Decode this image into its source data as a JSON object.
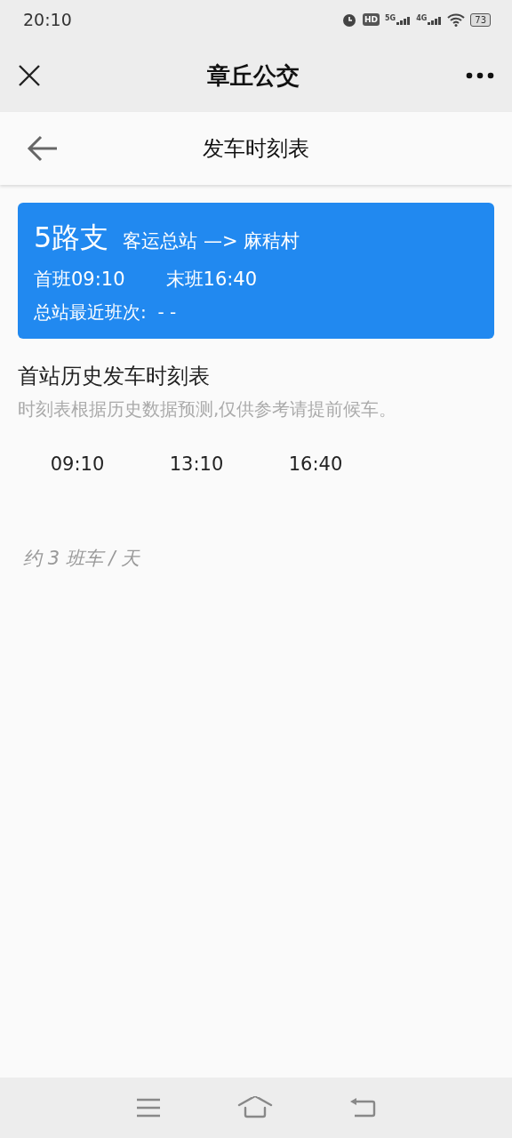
{
  "status_bar": {
    "time": "20:10",
    "hd": "HD",
    "network": [
      "5G",
      "4G"
    ],
    "battery": "73"
  },
  "window": {
    "title": "章丘公交"
  },
  "page": {
    "title": "发车时刻表"
  },
  "route_card": {
    "route": "5路支",
    "direction": "客运总站 —> 麻秸村",
    "first_bus": "首班09:10",
    "last_bus": "末班16:40",
    "latest": "总站最近班次:  - -"
  },
  "schedule": {
    "title": "首站历史发车时刻表",
    "note": "时刻表根据历史数据预测,仅供参考请提前候车。",
    "times": [
      "09:10",
      "13:10",
      "16:40"
    ],
    "summary": "约 3 班车 / 天"
  }
}
